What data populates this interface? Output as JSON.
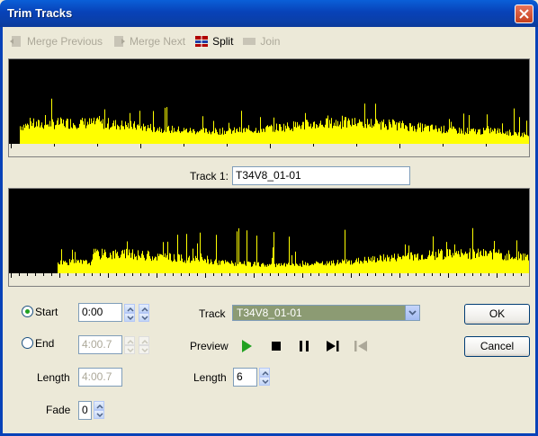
{
  "window": {
    "title": "Trim Tracks"
  },
  "toolbar": {
    "merge_previous": "Merge Previous",
    "merge_next": "Merge Next",
    "split": "Split",
    "join": "Join"
  },
  "track_label": {
    "label": "Track 1:",
    "value": "T34V8_01-01"
  },
  "controls": {
    "start_label": "Start",
    "start_value": "0:00",
    "end_label": "End",
    "end_value": "4:00.7",
    "length_label": "Length",
    "length_value": "4:00.7",
    "fade_label": "Fade",
    "fade_value": "0",
    "track_label": "Track",
    "track_value": "T34V8_01-01",
    "preview_label": "Preview",
    "preview_length_label": "Length",
    "preview_length_value": "6"
  },
  "buttons": {
    "ok": "OK",
    "cancel": "Cancel"
  },
  "colors": {
    "waveform": "#ffff00",
    "wave_bg": "#000000",
    "title_bar": "#0842b8",
    "play": "#21a121"
  },
  "state": {
    "start_selected": true,
    "end_selected": false
  }
}
